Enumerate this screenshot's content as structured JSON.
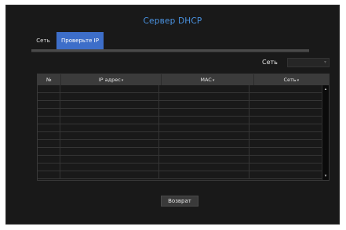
{
  "window": {
    "title": "Сервер DHCP"
  },
  "tabs": [
    {
      "label": "Сеть",
      "active": false
    },
    {
      "label": "Проверьте IP",
      "active": true
    }
  ],
  "filter": {
    "label": "Сеть",
    "value": ""
  },
  "table": {
    "columns": [
      "№",
      "IP адрес",
      "MAC",
      "Сеть"
    ],
    "sort_indicator": "▾",
    "rows": [
      [
        "",
        "",
        "",
        ""
      ],
      [
        "",
        "",
        "",
        ""
      ],
      [
        "",
        "",
        "",
        ""
      ],
      [
        "",
        "",
        "",
        ""
      ],
      [
        "",
        "",
        "",
        ""
      ],
      [
        "",
        "",
        "",
        ""
      ],
      [
        "",
        "",
        "",
        ""
      ],
      [
        "",
        "",
        "",
        ""
      ],
      [
        "",
        "",
        "",
        ""
      ],
      [
        "",
        "",
        "",
        ""
      ],
      [
        "",
        "",
        "",
        ""
      ],
      [
        "",
        "",
        "",
        ""
      ]
    ]
  },
  "scrollbar": {
    "up_icon": "▴",
    "down_icon": "▾"
  },
  "footer": {
    "back_label": "Возврат"
  },
  "colors": {
    "window_bg": "#191919",
    "title": "#4a93e2",
    "active_tab": "#3d6ec9",
    "header_bg": "#3b3b3b"
  }
}
